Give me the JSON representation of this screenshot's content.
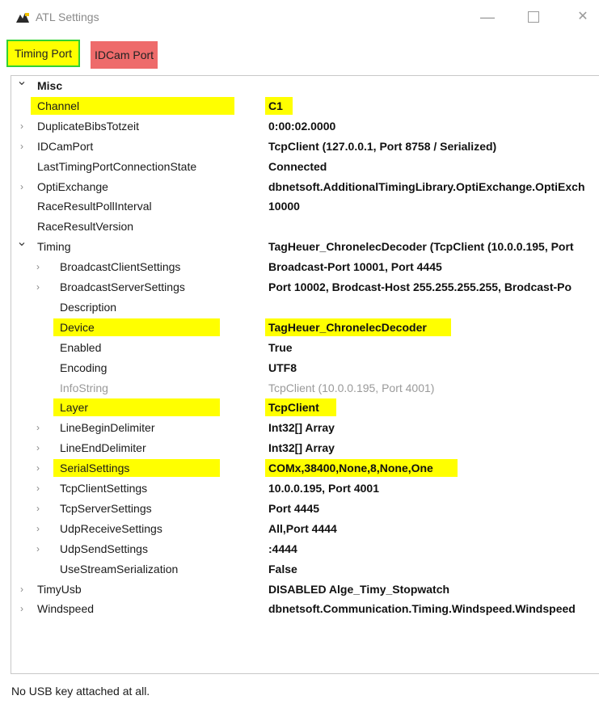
{
  "window": {
    "title": "ATL Settings",
    "controls": {
      "minimize": "—",
      "maximize": "",
      "close": "✕"
    }
  },
  "tabs": [
    {
      "label": "Timing Port",
      "color": "#ffff00",
      "border": "#32d232"
    },
    {
      "label": "IDCam Port",
      "color": "#ee6b6b"
    }
  ],
  "grid": {
    "rows": [
      {
        "name": "Misc",
        "value": "",
        "toggle": "open",
        "category": true
      },
      {
        "name": "Channel",
        "value": "C1",
        "highlight": true
      },
      {
        "name": "DuplicateBibsTotzeit",
        "value": "0:00:02.0000",
        "toggle": "closed"
      },
      {
        "name": "IDCamPort",
        "value": "TcpClient (127.0.0.1, Port 8758 / Serialized)",
        "toggle": "closed"
      },
      {
        "name": "LastTimingPortConnectionState",
        "value": "Connected"
      },
      {
        "name": "OptiExchange",
        "value": "dbnetsoft.AdditionalTimingLibrary.OptiExchange.OptiExch",
        "toggle": "closed"
      },
      {
        "name": "RaceResultPollInterval",
        "value": "10000"
      },
      {
        "name": "RaceResultVersion",
        "value": ""
      },
      {
        "name": "Timing",
        "value": "TagHeuer_ChronelecDecoder (TcpClient (10.0.0.195, Port",
        "toggle": "open"
      },
      {
        "name": "BroadcastClientSettings",
        "value": "Broadcast-Port 10001, Port 4445",
        "toggle": "closed",
        "indent": 1
      },
      {
        "name": "BroadcastServerSettings",
        "value": "Port 10002, Brodcast-Host 255.255.255.255, Brodcast-Po",
        "toggle": "closed",
        "indent": 1
      },
      {
        "name": "Description",
        "value": "",
        "indent": 1
      },
      {
        "name": "Device",
        "value": "TagHeuer_ChronelecDecoder",
        "indent": 1,
        "highlight": true
      },
      {
        "name": "Enabled",
        "value": "True",
        "indent": 1
      },
      {
        "name": "Encoding",
        "value": "UTF8",
        "indent": 1
      },
      {
        "name": "InfoString",
        "value": "TcpClient (10.0.0.195, Port 4001)",
        "indent": 1,
        "readonly": true
      },
      {
        "name": "Layer",
        "value": "TcpClient",
        "indent": 1,
        "highlight": true
      },
      {
        "name": "LineBeginDelimiter",
        "value": "Int32[] Array",
        "toggle": "closed",
        "indent": 1
      },
      {
        "name": "LineEndDelimiter",
        "value": "Int32[] Array",
        "toggle": "closed",
        "indent": 1
      },
      {
        "name": "SerialSettings",
        "value": "COMx,38400,None,8,None,One",
        "toggle": "closed",
        "indent": 1,
        "highlight": true
      },
      {
        "name": "TcpClientSettings",
        "value": "10.0.0.195, Port 4001",
        "toggle": "closed",
        "indent": 1
      },
      {
        "name": "TcpServerSettings",
        "value": "Port 4445",
        "toggle": "closed",
        "indent": 1
      },
      {
        "name": "UdpReceiveSettings",
        "value": "All,Port 4444",
        "toggle": "closed",
        "indent": 1
      },
      {
        "name": "UdpSendSettings",
        "value": ":4444",
        "toggle": "closed",
        "indent": 1
      },
      {
        "name": "UseStreamSerialization",
        "value": "False",
        "indent": 1
      },
      {
        "name": "TimyUsb",
        "value": "DISABLED Alge_Timy_Stopwatch",
        "toggle": "closed"
      },
      {
        "name": "Windspeed",
        "value": "dbnetsoft.Communication.Timing.Windspeed.Windspeed",
        "toggle": "closed"
      }
    ]
  },
  "statusbar": {
    "text": "No USB key attached at all."
  }
}
